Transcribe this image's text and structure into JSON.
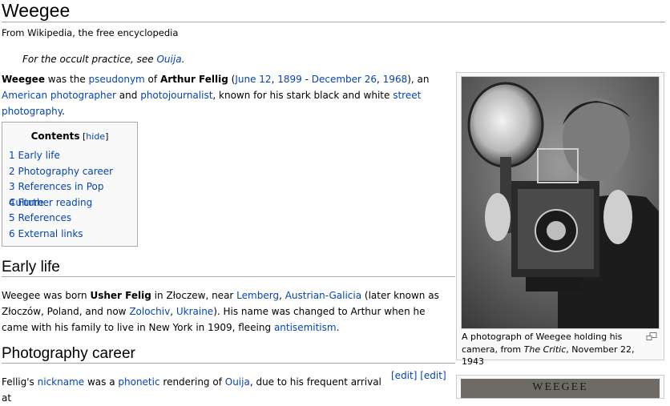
{
  "page": {
    "title": "Weegee",
    "subtitle": "From Wikipedia, the free encyclopedia",
    "dab": {
      "prefix": "For the occult practice, see ",
      "link": "Ouija",
      "suffix": "."
    }
  },
  "intro": {
    "s1": "Weegee",
    "s2": " was the ",
    "l1": "pseudonym",
    "s3": " of ",
    "s4": "Arthur Fellig",
    "s5": " (",
    "l2": "June 12",
    "s6": ", ",
    "l3": "1899",
    "s7": " - ",
    "l4": "December 26",
    "s8": ", ",
    "l5": "1968",
    "s9": "), an ",
    "l6": "American photographer",
    "s10": " and ",
    "l7": "photojournalist",
    "s11": ", known for his stark black and white ",
    "l8": "street photography",
    "s12": "."
  },
  "toc": {
    "title": "Contents",
    "hide_open": " [",
    "hide_label": "hide",
    "hide_close": "]",
    "items": [
      {
        "num": "1",
        "label": "Early life"
      },
      {
        "num": "2",
        "label": "Photography career"
      },
      {
        "num": "3",
        "label": "References in Pop Culture"
      },
      {
        "num": "4",
        "label": "Further reading"
      },
      {
        "num": "5",
        "label": "References"
      },
      {
        "num": "6",
        "label": "External links"
      }
    ]
  },
  "early_life": {
    "heading": "Early life",
    "s1": "Weegee was born ",
    "b1": "Usher Felig",
    "s2": " in Złoczew, near ",
    "l1": "Lemberg",
    "s3": ", ",
    "l2": "Austrian-Galicia",
    "s4": " (later known as Złoczów, Poland, and now ",
    "l3": "Zolochiv",
    "s5": ", ",
    "l4": "Ukraine",
    "s6": "). His name was changed to Arthur when he came with his family to live in New York in 1909, fleeing ",
    "l5": "antisemitism",
    "s7": "."
  },
  "career": {
    "heading": "Photography career",
    "edit1": "[edit]",
    "edit2": "[edit]",
    "s1": "Fellig's ",
    "l1": "nickname",
    "s2": " was a ",
    "l2": "phonetic",
    "s3": " rendering of ",
    "l3": "Ouija",
    "s4": ", due to his frequent arrival at"
  },
  "thumb": {
    "caption_prefix": "A photograph of Weegee holding his camera, from ",
    "caption_italic": "The Critic",
    "caption_suffix": ", November 22, 1943",
    "magnify_icon": "magnify-icon"
  },
  "thumb2": {
    "text": "WEEGEE"
  }
}
